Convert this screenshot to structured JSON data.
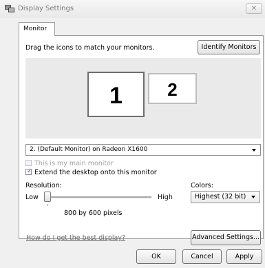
{
  "window": {
    "title": "Display Settings",
    "close_glyph": "✕"
  },
  "tabs": [
    {
      "label": "Monitor",
      "selected": true
    }
  ],
  "arrange": {
    "instruction": "Drag the icons to match your monitors.",
    "identify_label": "Identify Monitors",
    "monitors": [
      {
        "number": "1",
        "primary": true
      },
      {
        "number": "2",
        "primary": false
      }
    ]
  },
  "monitor_select": {
    "value": "2. (Default Monitor) on Radeon X1600"
  },
  "options": {
    "main_monitor": {
      "label": "This is my main monitor",
      "checked": false,
      "enabled": false
    },
    "extend_desktop": {
      "label": "Extend the desktop onto this monitor",
      "checked": true,
      "enabled": true
    }
  },
  "resolution": {
    "label": "Resolution:",
    "low": "Low",
    "high": "High",
    "value_text": "800 by 600 pixels",
    "slider_position": 0.0
  },
  "colors": {
    "label": "Colors:",
    "value": "Highest (32 bit)"
  },
  "help_link": "How do I get the best display?",
  "buttons": {
    "advanced": "Advanced Settings...",
    "ok": "OK",
    "cancel": "Cancel",
    "apply": "Apply"
  },
  "icons": {
    "app": "display-settings-icon",
    "close": "close-icon",
    "dropdown": "chevron-down-icon",
    "check": "checkmark-icon"
  }
}
